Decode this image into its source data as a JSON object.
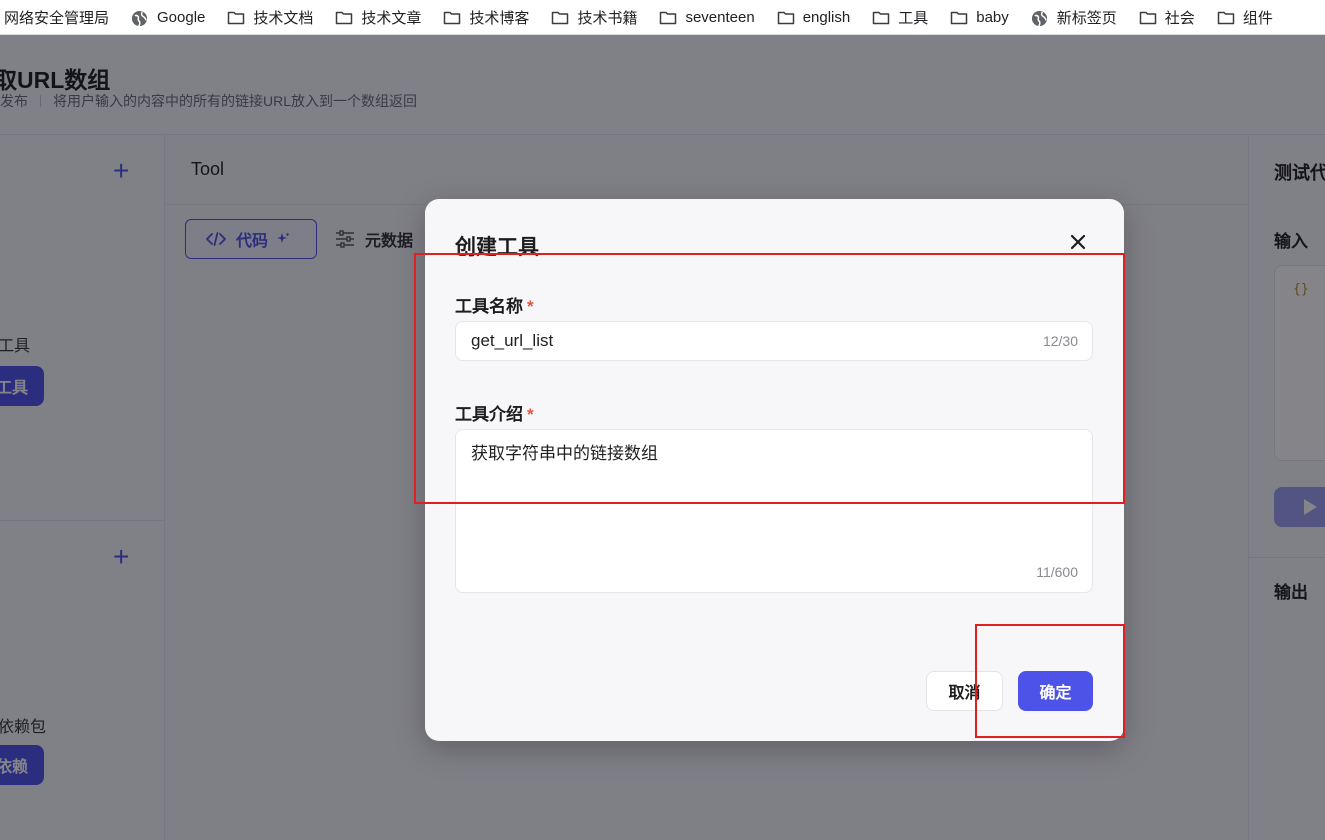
{
  "bookmarks": [
    {
      "label": "网络安全管理局",
      "icon": "none"
    },
    {
      "label": "Google",
      "icon": "globe-icon"
    },
    {
      "label": "技术文档",
      "icon": "folder-icon"
    },
    {
      "label": "技术文章",
      "icon": "folder-icon"
    },
    {
      "label": "技术博客",
      "icon": "folder-icon"
    },
    {
      "label": "技术书籍",
      "icon": "folder-icon"
    },
    {
      "label": "seventeen",
      "icon": "folder-icon"
    },
    {
      "label": "english",
      "icon": "folder-icon"
    },
    {
      "label": "工具",
      "icon": "folder-icon"
    },
    {
      "label": "baby",
      "icon": "folder-icon"
    },
    {
      "label": "新标签页",
      "icon": "globe-icon"
    },
    {
      "label": "社会",
      "icon": "folder-icon"
    },
    {
      "label": "组件",
      "icon": "folder-icon"
    }
  ],
  "page": {
    "title": "取URL数组",
    "status": "发布",
    "description": "将用户输入的内容中的所有的链接URL放入到一个数组返回"
  },
  "left_panel": {
    "tools_label": "工具",
    "tools_button": "工具",
    "deps_label": "依赖包",
    "deps_button": "依赖"
  },
  "center": {
    "title": "Tool",
    "tabs": [
      {
        "label": "代码",
        "icon": "code-icon",
        "active": true
      },
      {
        "label": "元数据",
        "icon": "sliders-icon",
        "active": false
      }
    ]
  },
  "right_panel": {
    "title": "测试代码",
    "input_label": "输入",
    "input_value": "{}",
    "output_label": "输出"
  },
  "modal": {
    "title": "创建工具",
    "name_label": "工具名称",
    "name_value": "get_url_list",
    "name_counter": "12/30",
    "desc_label": "工具介绍",
    "desc_value": "获取字符串中的链接数组",
    "desc_counter": "11/600",
    "required_mark": "*",
    "cancel_label": "取消",
    "ok_label": "确定"
  },
  "colors": {
    "accent": "#4d53e8",
    "required": "#e8553f",
    "annotation": "#e02020"
  }
}
